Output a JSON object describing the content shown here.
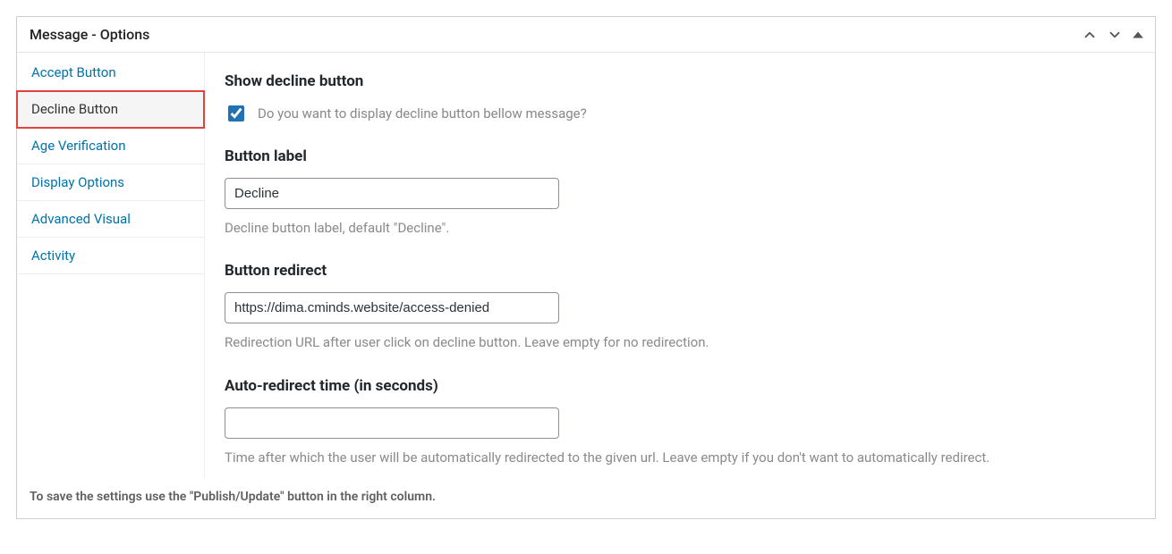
{
  "panel": {
    "title": "Message - Options"
  },
  "tabs": [
    {
      "label": "Accept Button",
      "active": false
    },
    {
      "label": "Decline Button",
      "active": true
    },
    {
      "label": "Age Verification",
      "active": false
    },
    {
      "label": "Display Options",
      "active": false
    },
    {
      "label": "Advanced Visual",
      "active": false
    },
    {
      "label": "Activity",
      "active": false
    }
  ],
  "fields": {
    "show_decline": {
      "heading": "Show decline button",
      "label": "Do you want to display decline button bellow message?",
      "checked": true
    },
    "button_label": {
      "heading": "Button label",
      "value": "Decline",
      "help": "Decline button label, default \"Decline\"."
    },
    "button_redirect": {
      "heading": "Button redirect",
      "value": "https://dima.cminds.website/access-denied",
      "help": "Redirection URL after user click on decline button. Leave empty for no redirection."
    },
    "auto_redirect": {
      "heading": "Auto-redirect time (in seconds)",
      "value": "",
      "help": "Time after which the user will be automatically redirected to the given url. Leave empty if you don't want to automatically redirect."
    }
  },
  "footer": "To save the settings use the \"Publish/Update\" button in the right column."
}
